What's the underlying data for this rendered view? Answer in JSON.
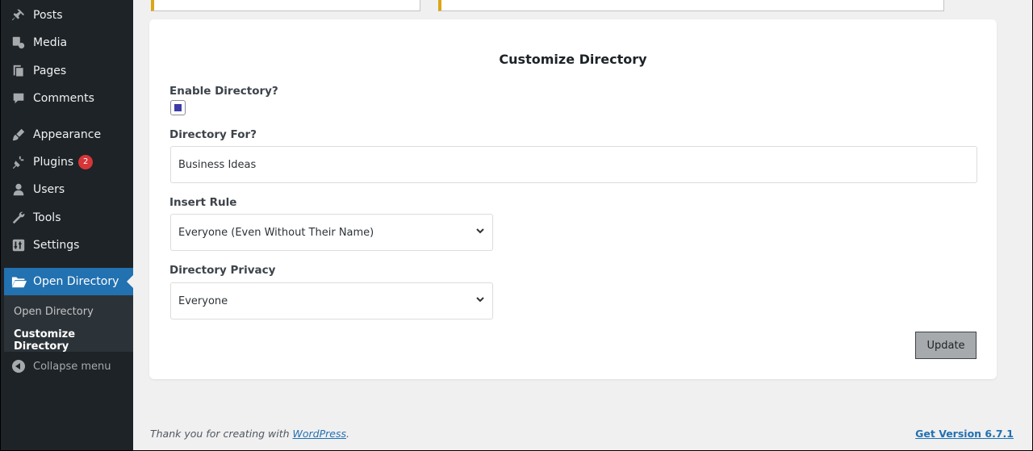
{
  "sidebar": {
    "items": [
      {
        "label": "Posts",
        "icon": "pin-icon"
      },
      {
        "label": "Media",
        "icon": "media-icon"
      },
      {
        "label": "Pages",
        "icon": "pages-icon"
      },
      {
        "label": "Comments",
        "icon": "comment-icon"
      },
      {
        "label": "Appearance",
        "icon": "brush-icon"
      },
      {
        "label": "Plugins",
        "icon": "plugin-icon",
        "badge": "2"
      },
      {
        "label": "Users",
        "icon": "user-icon"
      },
      {
        "label": "Tools",
        "icon": "wrench-icon"
      },
      {
        "label": "Settings",
        "icon": "settings-icon"
      }
    ],
    "active": {
      "label": "Open Directory",
      "icon": "folder-open-icon"
    },
    "submenu": [
      "Open Directory",
      "Customize Directory"
    ],
    "collapse_label": "Collapse menu"
  },
  "form": {
    "title": "Customize Directory",
    "enable_label": "Enable Directory?",
    "enable_checked": true,
    "directory_for_label": "Directory For?",
    "directory_for_value": "Business Ideas",
    "insert_rule_label": "Insert Rule",
    "insert_rule_value": "Everyone (Even Without Their Name)",
    "privacy_label": "Directory Privacy",
    "privacy_value": "Everyone",
    "update_label": "Update"
  },
  "footer": {
    "thanks_prefix": "Thank you for creating with ",
    "thanks_link": "WordPress",
    "thanks_suffix": ".",
    "version": "Get Version 6.7.1"
  },
  "colors": {
    "sidebar_bg": "#1d2327",
    "active_bg": "#2271b1",
    "badge": "#d63638",
    "accent_border": "#dba617"
  }
}
